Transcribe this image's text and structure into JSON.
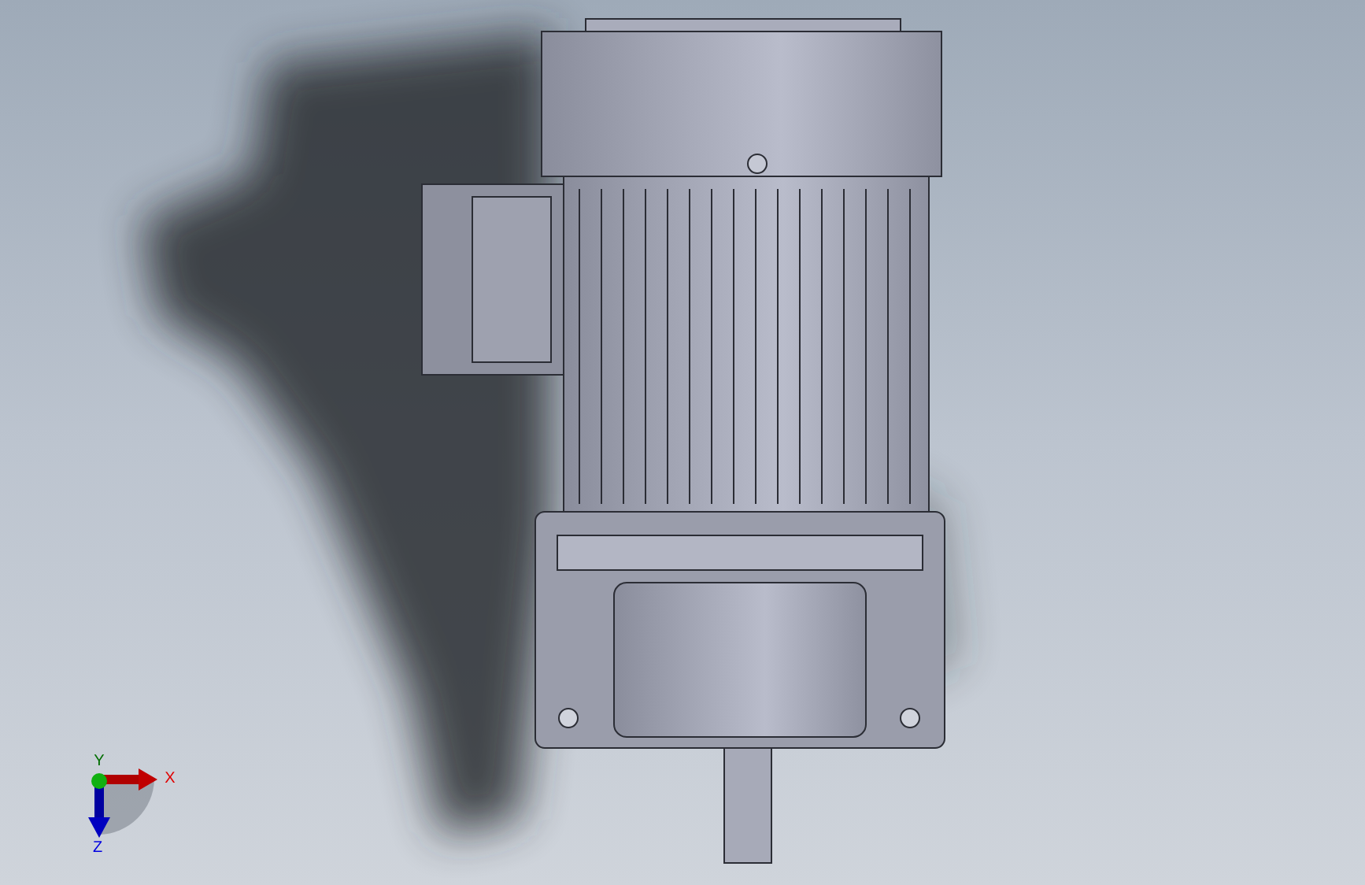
{
  "viewport": {
    "triad": [
      {
        "kind": "x",
        "text": "X"
      },
      {
        "kind": "y",
        "text": "Y"
      },
      {
        "kind": "z",
        "text": "Z"
      }
    ]
  }
}
